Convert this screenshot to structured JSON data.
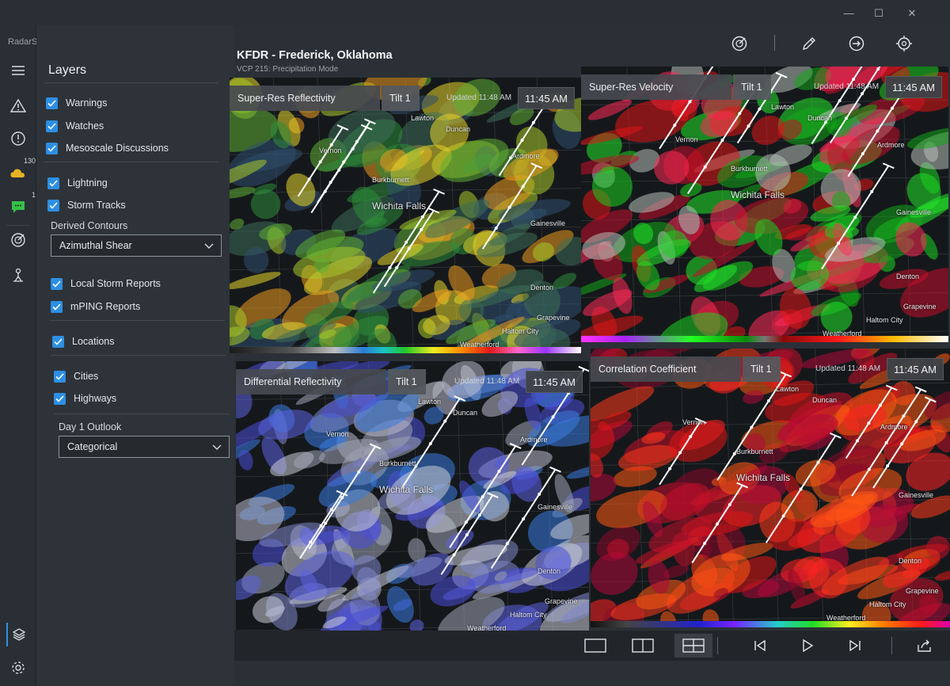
{
  "app": {
    "title": "RadarScope"
  },
  "window": {
    "minimize": "—",
    "maximize": "☐",
    "close": "✕"
  },
  "rail": {
    "lightning_badge": "130",
    "chat_badge": "1"
  },
  "layers": {
    "title": "Layers",
    "items": [
      {
        "label": "Warnings",
        "checked": true
      },
      {
        "label": "Watches",
        "checked": true
      },
      {
        "label": "Mesoscale Discussions",
        "checked": true
      },
      {
        "label": "Lightning",
        "checked": true
      },
      {
        "label": "Storm Tracks",
        "checked": true
      },
      {
        "label": "Local Storm Reports",
        "checked": true
      },
      {
        "label": "mPING Reports",
        "checked": true
      },
      {
        "label": "Locations",
        "checked": true
      },
      {
        "label": "Cities",
        "checked": true
      },
      {
        "label": "Highways",
        "checked": true
      }
    ],
    "derived_contours_label": "Derived Contours",
    "derived_contours_value": "Azimuthal Shear",
    "outlook_label": "Day 1 Outlook",
    "outlook_value": "Categorical"
  },
  "header": {
    "station": "KFDR - Frederick, Oklahoma",
    "vcp": "VCP 215: Precipitation Mode"
  },
  "panes": [
    {
      "product": "Super-Res Reflectivity",
      "tilt": "Tilt 1",
      "updated": "Updated 11:48 AM",
      "time": "11:45 AM",
      "scheme": "reflectivity"
    },
    {
      "product": "Super-Res Velocity",
      "tilt": "Tilt 1",
      "updated": "Updated 11:48 AM",
      "time": "11:45 AM",
      "scheme": "velocity"
    },
    {
      "product": "Differential Reflectivity",
      "tilt": "Tilt 1",
      "updated": "Updated 11:48 AM",
      "time": "11:45 AM",
      "scheme": "zdr"
    },
    {
      "product": "Correlation Coefficient",
      "tilt": "Tilt 1",
      "updated": "Updated 11:48 AM",
      "time": "11:45 AM",
      "scheme": "cc"
    }
  ],
  "cities": [
    "Lawton",
    "Duncan",
    "Vernon",
    "Burkburnett",
    "Wichita Falls",
    "Ardmore",
    "Gainesville",
    "Denton",
    "Grapevine",
    "Haltom City",
    "Weatherford"
  ],
  "colors": {
    "accent": "#2d8fe3",
    "warning_line": "#ffffff"
  },
  "bottom": {
    "layouts": [
      "single-pane",
      "two-pane",
      "four-pane"
    ],
    "active_layout": "four-pane",
    "playback": [
      "previous-frame",
      "play",
      "next-frame",
      "share"
    ]
  }
}
